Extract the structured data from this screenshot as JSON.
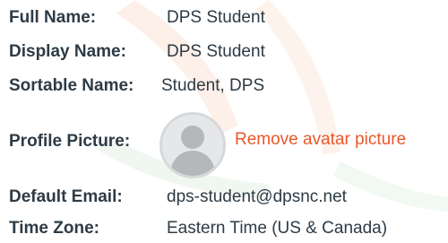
{
  "profile": {
    "full_name": {
      "label": "Full Name:",
      "value": "DPS Student"
    },
    "display_name": {
      "label": "Display Name:",
      "value": "DPS Student"
    },
    "sortable_name": {
      "label": "Sortable Name:",
      "value": "Student, DPS"
    },
    "profile_picture": {
      "label": "Profile Picture:",
      "avatar_icon": "default-user-avatar-icon",
      "remove_link": "Remove avatar picture"
    },
    "default_email": {
      "label": "Default Email:",
      "value": "dps-student@dpsnc.net"
    },
    "time_zone": {
      "label": "Time Zone:",
      "value": "Eastern Time (US & Canada)"
    }
  },
  "colors": {
    "text": "#2d3b45",
    "link": "#e8572a",
    "avatar_bg": "#e6e7e8",
    "avatar_figure": "#b5b8bb",
    "watermark_orange": "#fbe3d5",
    "watermark_green": "#e3f1e3"
  }
}
